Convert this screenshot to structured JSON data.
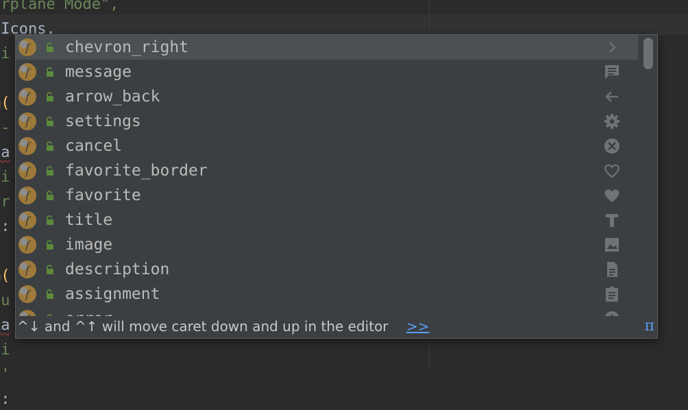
{
  "editor": {
    "lines": [
      {
        "text": "irplane Mode\",",
        "cls": "str"
      },
      {
        "text": " Icons.",
        "cls": ""
      },
      {
        "text": "ti",
        "cls": "str"
      },
      {
        "text": "",
        "cls": ""
      },
      {
        "text": "m(",
        "cls": "yellow"
      },
      {
        "text": "i-",
        "cls": "str"
      },
      {
        "text": "La",
        "cls": "squig"
      },
      {
        "text": "ti",
        "cls": "str"
      },
      {
        "text": "ir",
        "cls": "str"
      },
      {
        "text": "s:",
        "cls": ""
      },
      {
        "text": "",
        "cls": ""
      },
      {
        "text": "m(",
        "cls": "yellow"
      },
      {
        "text": "lu",
        "cls": "str"
      },
      {
        "text": "La",
        "cls": "squig"
      },
      {
        "text": "ti",
        "cls": "str"
      },
      {
        "text": "n'",
        "cls": "str"
      },
      {
        "text": "s:",
        "cls": ""
      }
    ]
  },
  "completion": {
    "items": [
      {
        "label": "chevron_right",
        "icon": "chevron-right-icon",
        "selected": true
      },
      {
        "label": "message",
        "icon": "message-icon",
        "selected": false
      },
      {
        "label": "arrow_back",
        "icon": "arrow-back-icon",
        "selected": false
      },
      {
        "label": "settings",
        "icon": "settings-icon",
        "selected": false
      },
      {
        "label": "cancel",
        "icon": "cancel-icon",
        "selected": false
      },
      {
        "label": "favorite_border",
        "icon": "favorite-border-icon",
        "selected": false
      },
      {
        "label": "favorite",
        "icon": "favorite-icon",
        "selected": false
      },
      {
        "label": "title",
        "icon": "title-icon",
        "selected": false
      },
      {
        "label": "image",
        "icon": "image-icon",
        "selected": false
      },
      {
        "label": "description",
        "icon": "description-icon",
        "selected": false
      },
      {
        "label": "assignment",
        "icon": "assignment-icon",
        "selected": false
      },
      {
        "label": "error",
        "icon": "error-icon",
        "selected": false
      }
    ],
    "badge_letter": "f",
    "footer_hint": "^↓ and ^↑ will move caret down and up in the editor",
    "footer_link": ">>",
    "footer_pi": "π"
  },
  "colors": {
    "background": "#2b2b2b",
    "popup": "#3c3f41",
    "selected_row": "#4b5052",
    "badge": "#9e7a3a",
    "lock": "#5c8a3c",
    "link": "#589df6",
    "icon": "#6f7375"
  }
}
